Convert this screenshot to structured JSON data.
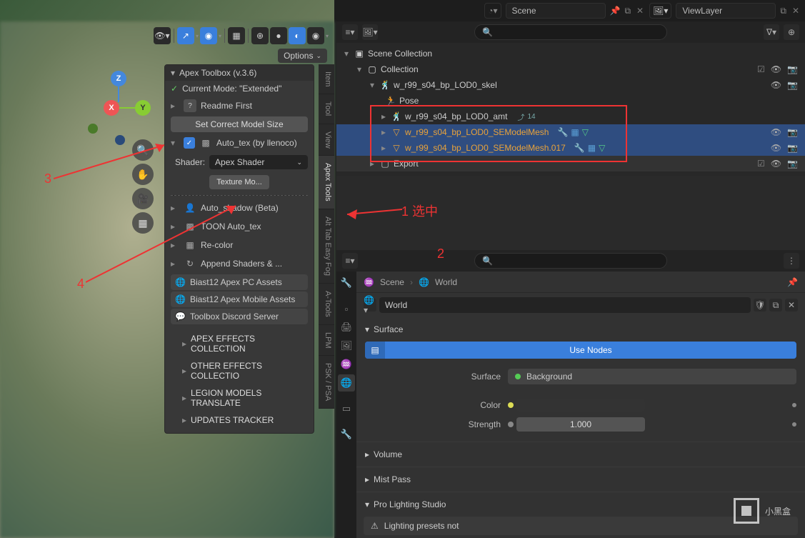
{
  "header": {
    "scene_label": "Scene",
    "viewlayer_label": "ViewLayer"
  },
  "viewport": {
    "options_label": "Options",
    "gizmo": {
      "x": "X",
      "y": "Y",
      "z": "Z"
    }
  },
  "npanel": {
    "title": "Apex Toolbox (v.3.6)",
    "mode_label": "Current Mode:  \"Extended\"",
    "readme": "Readme First",
    "set_size": "Set Correct Model Size",
    "autotex": "Auto_tex (by llenoco)",
    "shader_label": "Shader:",
    "shader_value": "Apex Shader",
    "texture_btn": "Texture Mo...",
    "items": [
      "Auto_shadow (Beta)",
      "TOON Auto_tex",
      "Re-color",
      "Append Shaders & ..."
    ],
    "links": [
      "Biast12 Apex PC Assets",
      "Biast12 Apex Mobile Assets",
      "Toolbox Discord Server"
    ],
    "sections": [
      "APEX EFFECTS COLLECTION",
      "OTHER EFFECTS COLLECTIO",
      "LEGION MODELS TRANSLATE",
      "UPDATES TRACKER"
    ]
  },
  "vtabs": [
    "Item",
    "Tool",
    "View",
    "Apex Tools",
    "Alt Tab Easy Fog",
    "A-Tools",
    "LPM",
    "PSK / PSA"
  ],
  "outliner": {
    "scene_collection": "Scene Collection",
    "collection": "Collection",
    "skel": "w_r99_s04_bp_LOD0_skel",
    "pose": "Pose",
    "amt": "w_r99_s04_bp_LOD0_amt",
    "amt_badge": "14",
    "mesh1": "w_r99_s04_bp_LOD0_SEModelMesh",
    "mesh2": "w_r99_s04_bp_LOD0_SEModelMesh.017",
    "export": "Export"
  },
  "search_placeholder": "",
  "anno": {
    "a1": "1  选中",
    "a2": "2",
    "a3": "3",
    "a4": "4"
  },
  "props": {
    "crumb_scene": "Scene",
    "crumb_world": "World",
    "world_label": "World",
    "surface_hdr": "Surface",
    "use_nodes": "Use Nodes",
    "surface_label": "Surface",
    "background": "Background",
    "color_label": "Color",
    "strength_label": "Strength",
    "strength_value": "1.000",
    "volume_hdr": "Volume",
    "mist_hdr": "Mist Pass",
    "pro_hdr": "Pro Lighting Studio",
    "warn": "Lighting presets not"
  },
  "watermark": "小黑盒"
}
